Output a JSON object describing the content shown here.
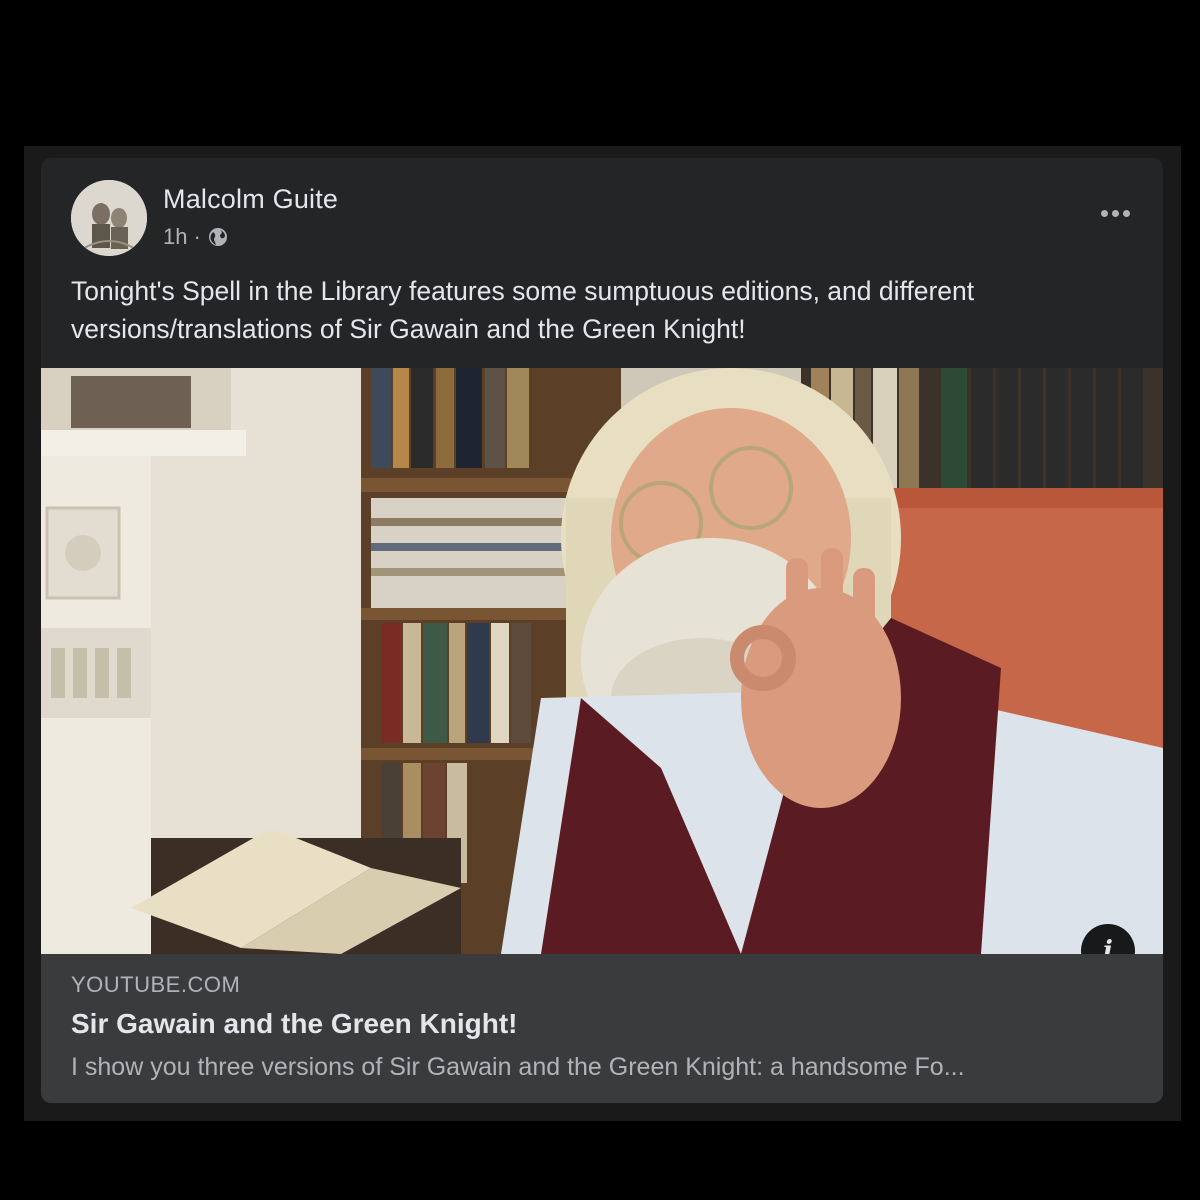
{
  "post": {
    "author": "Malcolm Guite",
    "time": "1h",
    "separator": "·",
    "audience_icon": "globe-icon",
    "more_icon": "more-options-icon",
    "text": "Tonight's Spell in the Library features some sumptuous editions, and different versions/translations of Sir Gawain and the Green Knight!"
  },
  "link": {
    "domain": "YOUTUBE.COM",
    "title": "Sir Gawain and the Green Knight!",
    "description": "I show you three versions of Sir Gawain and the Green Knight: a handsome Fo...",
    "info_icon": "info-icon",
    "info_glyph": "i"
  },
  "colors": {
    "card_background": "#242526",
    "link_box_background": "#3a3b3c",
    "primary_text": "#e4e6eb",
    "secondary_text": "#b0b3b8"
  }
}
